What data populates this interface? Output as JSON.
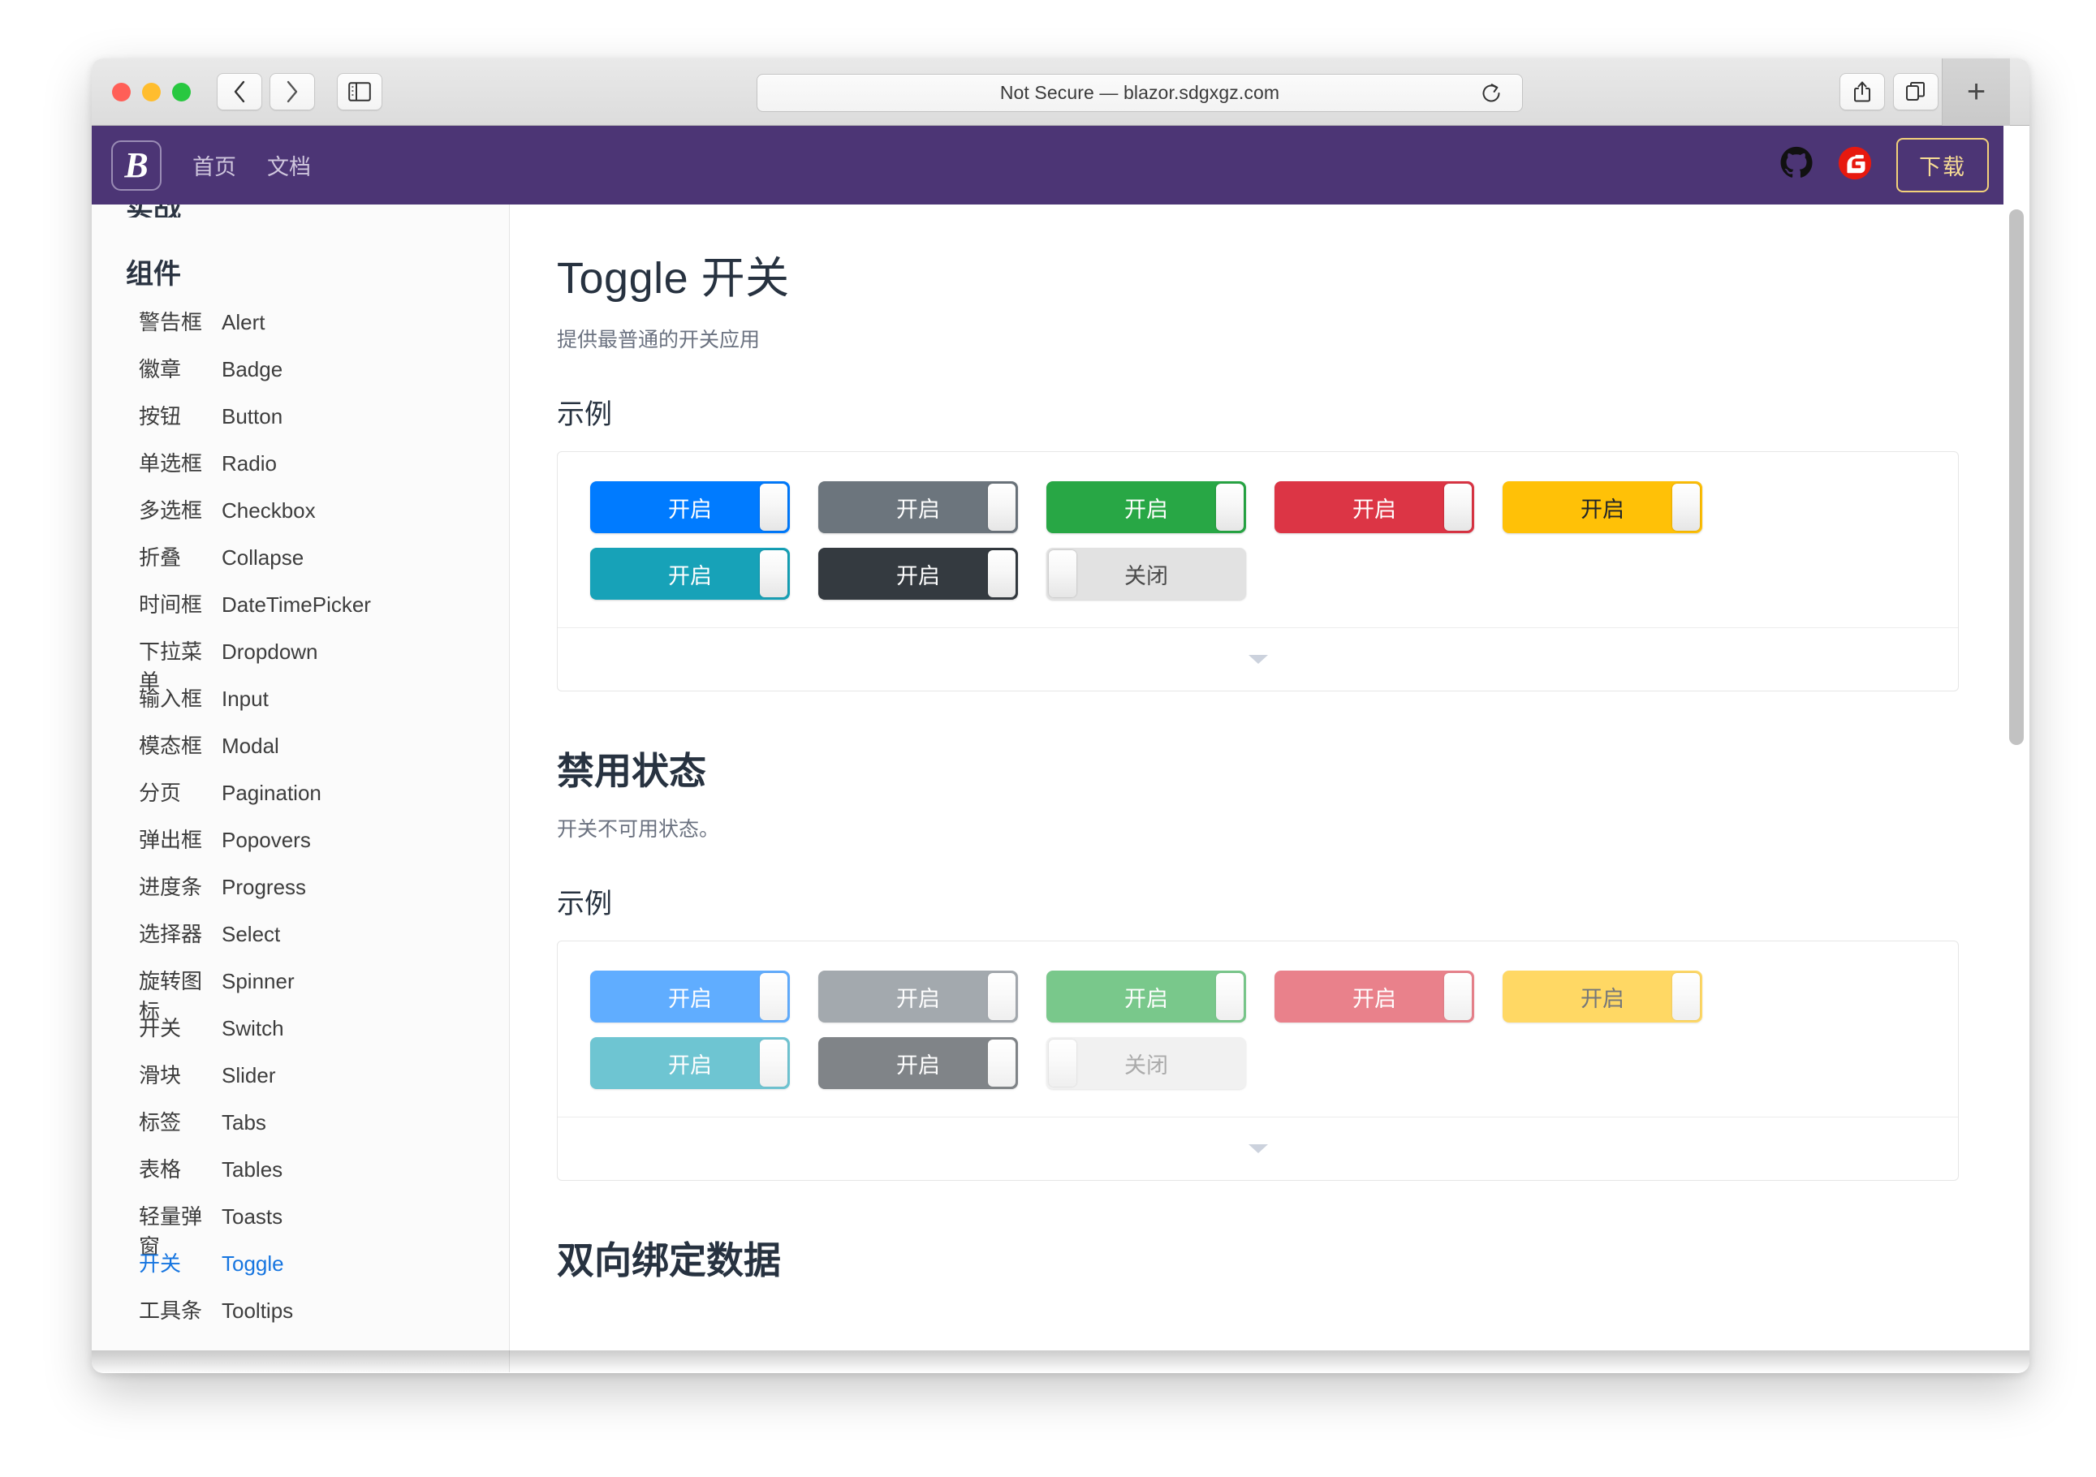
{
  "browser": {
    "address": "Not Secure — blazor.sdgxgz.com",
    "back_icon": "chevron-left-icon",
    "forward_icon": "chevron-right-icon",
    "sidebar_icon": "sidebar-toggle-icon",
    "reload_icon": "reload-icon",
    "share_icon": "share-icon",
    "tabs_icon": "tab-overview-icon",
    "newtab_label": "+"
  },
  "navbar": {
    "brand_letter": "B",
    "links": [
      {
        "label": "首页"
      },
      {
        "label": "文档"
      }
    ],
    "github_icon": "github-icon",
    "gitee_icon": "gitee-icon",
    "download_label": "下载",
    "background": "#4c3575",
    "download_border": "#f3d27a"
  },
  "sidebar": {
    "clipped_heading": "实战",
    "section_title": "组件",
    "items": [
      {
        "cn": "警告框",
        "en": "Alert",
        "active": false
      },
      {
        "cn": "徽章",
        "en": "Badge",
        "active": false
      },
      {
        "cn": "按钮",
        "en": "Button",
        "active": false
      },
      {
        "cn": "单选框",
        "en": "Radio",
        "active": false
      },
      {
        "cn": "多选框",
        "en": "Checkbox",
        "active": false
      },
      {
        "cn": "折叠",
        "en": "Collapse",
        "active": false
      },
      {
        "cn": "时间框",
        "en": "DateTimePicker",
        "active": false
      },
      {
        "cn": "下拉菜单",
        "en": "Dropdown",
        "active": false
      },
      {
        "cn": "输入框",
        "en": "Input",
        "active": false
      },
      {
        "cn": "模态框",
        "en": "Modal",
        "active": false
      },
      {
        "cn": "分页",
        "en": "Pagination",
        "active": false
      },
      {
        "cn": "弹出框",
        "en": "Popovers",
        "active": false
      },
      {
        "cn": "进度条",
        "en": "Progress",
        "active": false
      },
      {
        "cn": "选择器",
        "en": "Select",
        "active": false
      },
      {
        "cn": "旋转图标",
        "en": "Spinner",
        "active": false
      },
      {
        "cn": "开关",
        "en": "Switch",
        "active": false
      },
      {
        "cn": "滑块",
        "en": "Slider",
        "active": false
      },
      {
        "cn": "标签",
        "en": "Tabs",
        "active": false
      },
      {
        "cn": "表格",
        "en": "Tables",
        "active": false
      },
      {
        "cn": "轻量弹窗",
        "en": "Toasts",
        "active": false
      },
      {
        "cn": "开关",
        "en": "Toggle",
        "active": true
      },
      {
        "cn": "工具条",
        "en": "Tooltips",
        "active": false
      }
    ],
    "active_color": "#1675e0"
  },
  "main": {
    "title": "Toggle 开关",
    "subtitle": "提供最普通的开关应用",
    "section1_heading": "示例",
    "section2_title": "禁用状态",
    "section2_subtitle": "开关不可用状态。",
    "section2_heading": "示例",
    "section3_title": "双向绑定数据",
    "expand_icon": "chevron-down-icon",
    "examples": {
      "enabled": [
        [
          {
            "label": "开启",
            "state": "on",
            "color": "#007bff",
            "text_color": "#ffffff",
            "disabled": false
          },
          {
            "label": "开启",
            "state": "on",
            "color": "#6c757d",
            "text_color": "#ffffff",
            "disabled": false
          },
          {
            "label": "开启",
            "state": "on",
            "color": "#28a745",
            "text_color": "#ffffff",
            "disabled": false
          },
          {
            "label": "开启",
            "state": "on",
            "color": "#dc3545",
            "text_color": "#ffffff",
            "disabled": false
          },
          {
            "label": "开启",
            "state": "on",
            "color": "#ffc107",
            "text_color": "#212529",
            "disabled": false
          }
        ],
        [
          {
            "label": "开启",
            "state": "on",
            "color": "#17a2b8",
            "text_color": "#ffffff",
            "disabled": false
          },
          {
            "label": "开启",
            "state": "on",
            "color": "#343a40",
            "text_color": "#ffffff",
            "disabled": false
          },
          {
            "label": "关闭",
            "state": "off",
            "color": "#e2e2e2",
            "text_color": "#4a4a4a",
            "disabled": false
          }
        ]
      ],
      "disabled": [
        [
          {
            "label": "开启",
            "state": "on",
            "color": "#007bff",
            "text_color": "#ffffff",
            "disabled": true
          },
          {
            "label": "开启",
            "state": "on",
            "color": "#6c757d",
            "text_color": "#ffffff",
            "disabled": true
          },
          {
            "label": "开启",
            "state": "on",
            "color": "#28a745",
            "text_color": "#ffffff",
            "disabled": true
          },
          {
            "label": "开启",
            "state": "on",
            "color": "#dc3545",
            "text_color": "#ffffff",
            "disabled": true
          },
          {
            "label": "开启",
            "state": "on",
            "color": "#ffc107",
            "text_color": "#212529",
            "disabled": true
          }
        ],
        [
          {
            "label": "开启",
            "state": "on",
            "color": "#17a2b8",
            "text_color": "#ffffff",
            "disabled": true
          },
          {
            "label": "开启",
            "state": "on",
            "color": "#343a40",
            "text_color": "#ffffff",
            "disabled": true
          },
          {
            "label": "关闭",
            "state": "off",
            "color": "#e9e9e9",
            "text_color": "#777777",
            "disabled": true
          }
        ]
      ]
    }
  }
}
